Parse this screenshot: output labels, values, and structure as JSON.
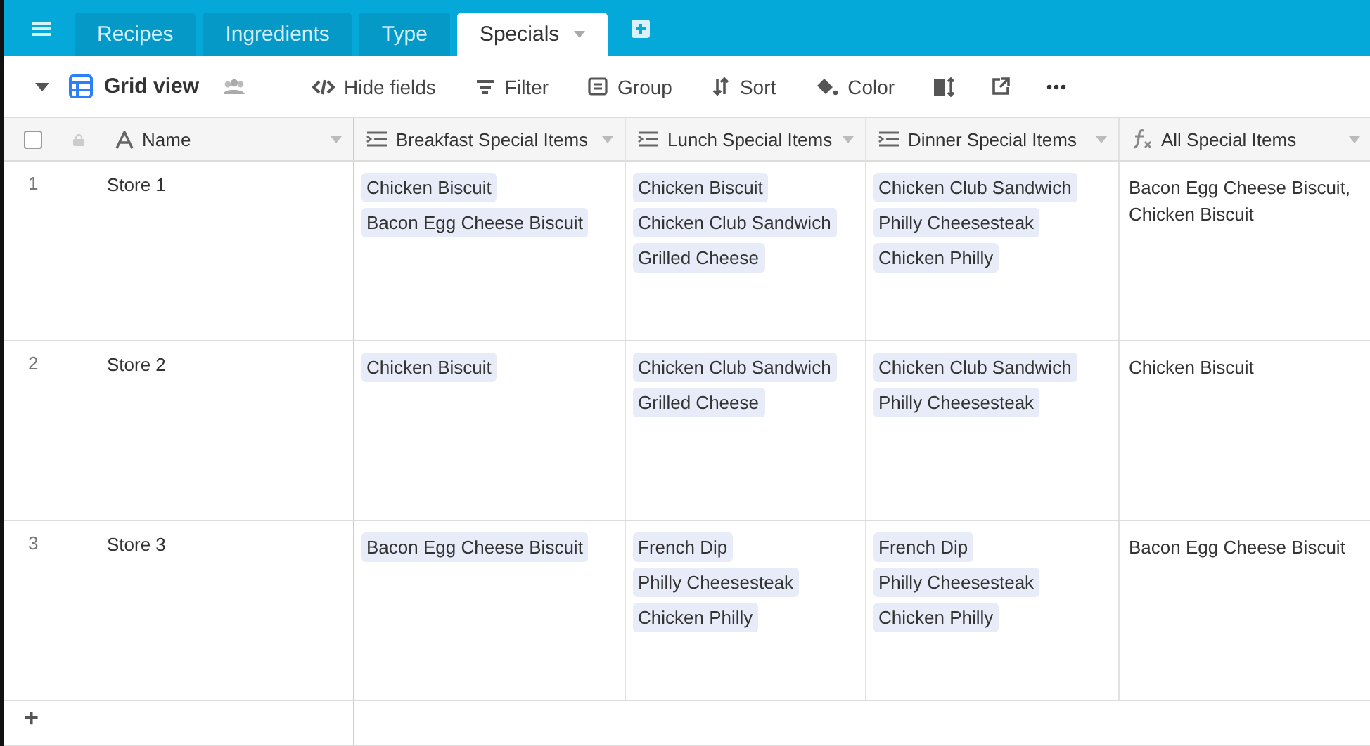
{
  "tabs": [
    {
      "label": "Recipes",
      "selected": false
    },
    {
      "label": "Ingredients",
      "selected": false
    },
    {
      "label": "Type",
      "selected": false
    },
    {
      "label": "Specials",
      "selected": true
    }
  ],
  "view": {
    "label": "Grid view"
  },
  "toolbar": [
    {
      "kind": "hide",
      "label": "Hide fields"
    },
    {
      "kind": "filter",
      "label": "Filter"
    },
    {
      "kind": "group",
      "label": "Group"
    },
    {
      "kind": "sort",
      "label": "Sort"
    },
    {
      "kind": "color",
      "label": "Color"
    },
    {
      "kind": "height"
    },
    {
      "kind": "share"
    },
    {
      "kind": "more"
    }
  ],
  "table": {
    "select_all": {
      "checked": false
    },
    "columns": [
      {
        "label": "Name",
        "kind": "text"
      },
      {
        "label": "Breakfast Special Items",
        "kind": "link"
      },
      {
        "label": "Lunch Special Items",
        "kind": "link"
      },
      {
        "label": "Dinner Special Items",
        "kind": "link"
      },
      {
        "label": "All Special Items",
        "kind": "formula"
      }
    ],
    "rows": [
      {
        "number": "1",
        "name": "Store 1",
        "breakfast": [
          "Chicken Biscuit",
          "Bacon Egg Cheese Biscuit"
        ],
        "lunch": [
          "Chicken Biscuit",
          "Chicken Club Sandwich",
          "Grilled Cheese"
        ],
        "dinner": [
          "Chicken Club Sandwich",
          "Philly Cheesesteak",
          "Chicken Philly"
        ],
        "all": "Bacon Egg Cheese Biscuit, Chicken Biscuit"
      },
      {
        "number": "2",
        "name": "Store 2",
        "breakfast": [
          "Chicken Biscuit"
        ],
        "lunch": [
          "Chicken Club Sandwich",
          "Grilled Cheese"
        ],
        "dinner": [
          "Chicken Club Sandwich",
          "Philly Cheesesteak"
        ],
        "all": "Chicken Biscuit"
      },
      {
        "number": "3",
        "name": "Store 3",
        "breakfast": [
          "Bacon Egg Cheese Biscuit"
        ],
        "lunch": [
          "French Dip",
          "Philly Cheesesteak",
          "Chicken Philly"
        ],
        "dinner": [
          "French Dip",
          "Philly Cheesesteak",
          "Chicken Philly"
        ],
        "all": "Bacon Egg Cheese Biscuit"
      }
    ]
  },
  "add_row": {
    "label": "+"
  }
}
